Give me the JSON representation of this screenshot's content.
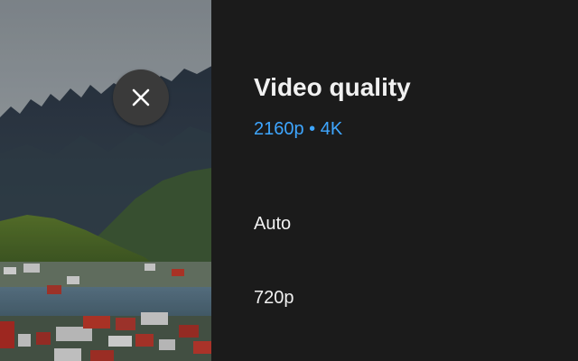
{
  "panel": {
    "title": "Video quality",
    "current_quality": "2160p • 4K",
    "options": [
      {
        "label": "Auto"
      },
      {
        "label": "720p"
      }
    ]
  },
  "close_button": {
    "icon": "close-icon"
  },
  "colors": {
    "panel_background": "#1b1b1b",
    "accent_blue": "#3ea6ff",
    "text_primary": "#f1f1f1",
    "close_button_background": "#3a3a3a"
  }
}
